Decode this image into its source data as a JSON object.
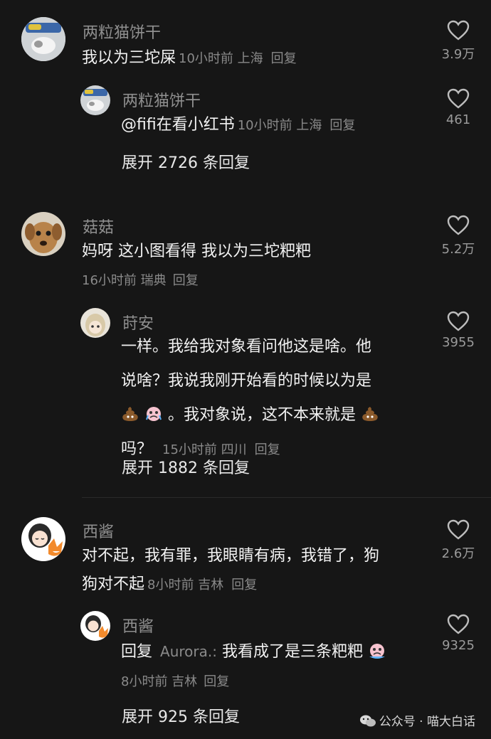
{
  "threads": [
    {
      "author": "两粒猫饼干",
      "text": "我以为三坨屎",
      "meta": "10小时前 上海",
      "reply": "回复",
      "likes": "3.9万",
      "sub": {
        "author": "两粒猫饼干",
        "text": "@fifi在看小红书",
        "meta": "10小时前 上海",
        "reply": "回复",
        "likes": "461"
      },
      "expand": "展开 2726 条回复"
    },
    {
      "author": "菇菇",
      "text": "妈呀 这小图看得 我以为三坨粑粑",
      "meta": "16小时前 瑞典",
      "reply": "回复",
      "likes": "5.2万",
      "sub": {
        "author": "莳安",
        "line1": "一样。我给我对象看问他这是啥。他",
        "line2": "说啥？我说我刚开始看的时候以为是",
        "line3": "。我对象说，这不本来就是",
        "line4": "吗？",
        "meta": "15小时前 四川",
        "reply": "回复",
        "likes": "3955"
      },
      "expand": "展开 1882 条回复"
    },
    {
      "author": "西酱",
      "line1": "对不起，我有罪，我眼睛有病，我错了，狗",
      "line2": "狗对不起",
      "meta": "8小时前 吉林",
      "reply": "回复",
      "likes": "2.6万",
      "sub": {
        "author": "西酱",
        "prefix": "回复",
        "mention": "Aurora.:",
        "text": " 我看成了是三条粑粑",
        "meta": "8小时前 吉林",
        "reply": "回复",
        "likes": "9325"
      },
      "expand": "展开 925 条回复"
    }
  ],
  "watermark": "公众号 · 喵大白话",
  "colors": {
    "background": "#161616",
    "text": "#f2f2f2",
    "muted": "#8a8a8a"
  }
}
